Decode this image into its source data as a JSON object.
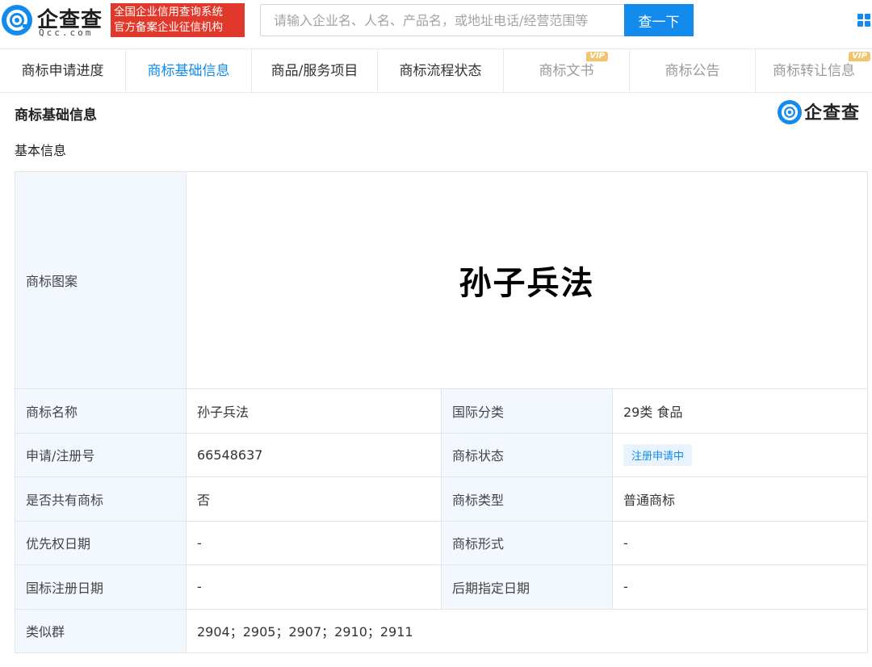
{
  "header": {
    "logo_cn": "企查查",
    "logo_en": "Qcc.com",
    "badge_line1": "全国企业信用查询系统",
    "badge_line2": "官方备案企业征信机构",
    "search_placeholder": "请输入企业名、人名、产品名，或地址电话/经营范围等",
    "search_button": "查一下"
  },
  "tabs": [
    {
      "label": "商标申请进度",
      "state": "normal"
    },
    {
      "label": "商标基础信息",
      "state": "active"
    },
    {
      "label": "商品/服务项目",
      "state": "normal"
    },
    {
      "label": "商标流程状态",
      "state": "normal"
    },
    {
      "label": "商标文书",
      "state": "disabled",
      "badge": "VIP"
    },
    {
      "label": "商标公告",
      "state": "disabled"
    },
    {
      "label": "商标转让信息",
      "state": "disabled",
      "badge": "VIP"
    }
  ],
  "section": {
    "title": "商标基础信息",
    "watermark": "企查查",
    "subtitle": "基本信息"
  },
  "table": {
    "image_label": "商标图案",
    "image_text": "孙子兵法",
    "rows": [
      {
        "l1": "商标名称",
        "v1": "孙子兵法",
        "l2": "国际分类",
        "v2": "29类 食品"
      },
      {
        "l1": "申请/注册号",
        "v1": "66548637",
        "l2": "商标状态",
        "v2": "注册申请中"
      },
      {
        "l1": "是否共有商标",
        "v1": "否",
        "l2": "商标类型",
        "v2": "普通商标"
      },
      {
        "l1": "优先权日期",
        "v1": "-",
        "l2": "商标形式",
        "v2": "-"
      },
      {
        "l1": "国标注册日期",
        "v1": "-",
        "l2": "后期指定日期",
        "v2": "-"
      }
    ],
    "similar_label": "类似群",
    "similar_value": "2904；2905；2907；2910；2911"
  },
  "colors": {
    "brand": "#128bed",
    "badge_red": "#e0392b",
    "label_bg": "#f2f8fe",
    "vip_gold": "#f2c46f"
  }
}
